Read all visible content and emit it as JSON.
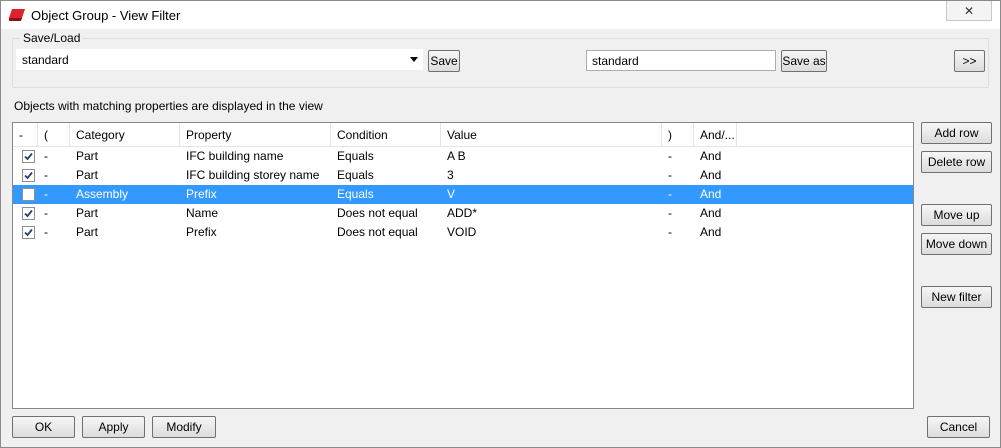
{
  "window": {
    "title": "Object Group - View Filter",
    "close_symbol": "✕"
  },
  "save_load": {
    "group_label": "Save/Load",
    "combo_value": "standard",
    "save_label": "Save",
    "save_as_value": "standard",
    "save_as_label": "Save as",
    "expand_label": ">>"
  },
  "hint": "Objects with matching properties are displayed in the view",
  "table": {
    "headers": [
      "-",
      "(",
      "Category",
      "Property",
      "Condition",
      "Value",
      ")",
      "And/..."
    ],
    "rows": [
      {
        "checked": true,
        "open": "-",
        "category": "Part",
        "property": "IFC building name",
        "condition": "Equals",
        "value": "A B",
        "close": "-",
        "andor": "And",
        "selected": false
      },
      {
        "checked": true,
        "open": "-",
        "category": "Part",
        "property": "IFC building storey name",
        "condition": "Equals",
        "value": "3",
        "close": "-",
        "andor": "And",
        "selected": false
      },
      {
        "checked": false,
        "open": "-",
        "category": "Assembly",
        "property": "Prefix",
        "condition": "Equals",
        "value": "V",
        "close": "-",
        "andor": "And",
        "selected": true
      },
      {
        "checked": true,
        "open": "-",
        "category": "Part",
        "property": "Name",
        "condition": "Does not equal",
        "value": "ADD*",
        "close": "-",
        "andor": "And",
        "selected": false
      },
      {
        "checked": true,
        "open": "-",
        "category": "Part",
        "property": "Prefix",
        "condition": "Does not equal",
        "value": "VOID",
        "close": "-",
        "andor": "And",
        "selected": false
      }
    ]
  },
  "side_buttons": {
    "add_row": "Add row",
    "delete_row": "Delete row",
    "move_up": "Move up",
    "move_down": "Move down",
    "new_filter": "New filter"
  },
  "bottom_buttons": {
    "ok": "OK",
    "apply": "Apply",
    "modify": "Modify",
    "cancel": "Cancel"
  },
  "colors": {
    "selection": "#3399ff",
    "app_icon": "#d9232d"
  }
}
